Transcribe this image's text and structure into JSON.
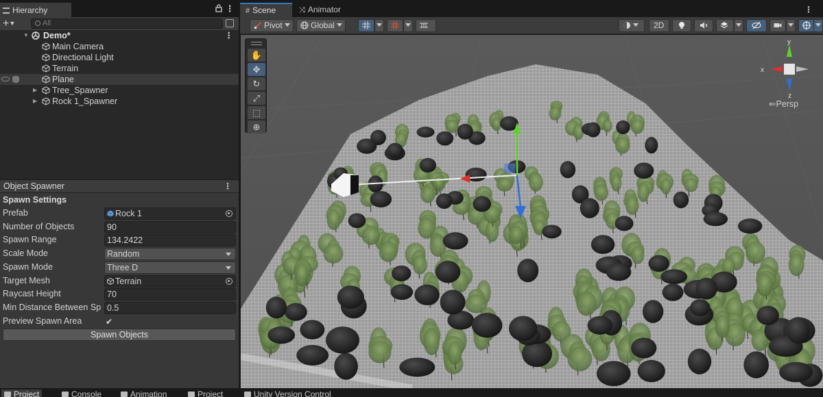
{
  "hierarchy": {
    "tab_label": "Hierarchy",
    "search_placeholder": "All",
    "scene_name": "Demo*",
    "items": [
      {
        "label": "Main Camera"
      },
      {
        "label": "Directional Light"
      },
      {
        "label": "Terrain"
      },
      {
        "label": "Plane"
      },
      {
        "label": "Tree_Spawner"
      },
      {
        "label": "Rock 1_Spawner"
      }
    ]
  },
  "inspector": {
    "title": "Object Spawner",
    "section": "Spawn Settings",
    "prefab_label": "Prefab",
    "prefab_value": "Rock 1",
    "num_objects_label": "Number of Objects",
    "num_objects_value": "90",
    "spawn_range_label": "Spawn Range",
    "spawn_range_value": "134.2422",
    "scale_mode_label": "Scale Mode",
    "scale_mode_value": "Random",
    "spawn_mode_label": "Spawn Mode",
    "spawn_mode_value": "Three D",
    "target_mesh_label": "Target Mesh",
    "target_mesh_value": "Terrain",
    "raycast_height_label": "Raycast Height",
    "raycast_height_value": "70",
    "min_distance_label": "Min Distance Between Sp",
    "min_distance_value": "0.5",
    "preview_label": "Preview Spawn Area",
    "preview_checked": "✔",
    "spawn_button": "Spawn Objects"
  },
  "scene_view": {
    "tabs": [
      {
        "label": "Scene"
      },
      {
        "label": "Animator"
      }
    ],
    "pivot_label": "Pivot",
    "global_label": "Global",
    "mode_2d": "2D",
    "persp_label": "Persp",
    "axis_x": "x",
    "axis_y": "y",
    "axis_z": "z"
  },
  "bottom_tabs": [
    {
      "label": "Project"
    },
    {
      "label": "Console"
    },
    {
      "label": "Animation"
    },
    {
      "label": "Project"
    },
    {
      "label": "Unity Version Control"
    }
  ],
  "colors": {
    "accent": "#3a79bb",
    "panel": "#383838",
    "x_axis": "#e0302c",
    "y_axis": "#5fd12f",
    "z_axis": "#2f6fd8"
  }
}
